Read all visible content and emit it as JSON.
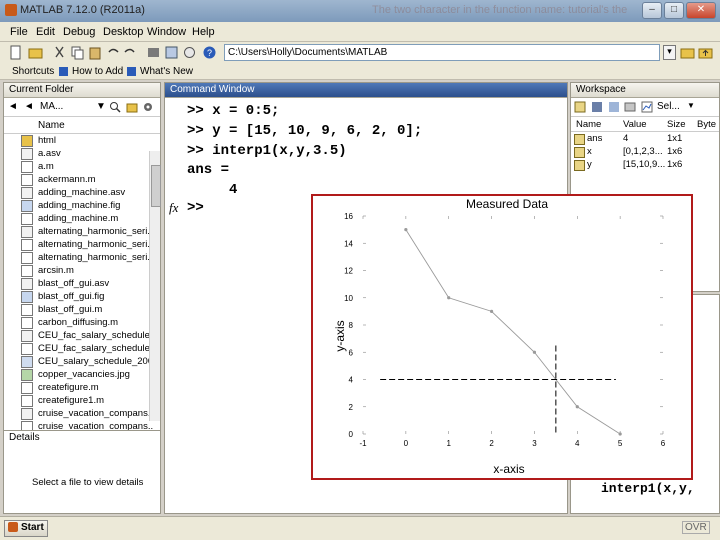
{
  "window": {
    "title": "MATLAB 7.12.0 (R2011a)",
    "background_title": "The two character in the function name: tutorial's the"
  },
  "menu": [
    "File",
    "Edit",
    "Debug",
    "Desktop",
    "Window",
    "Help"
  ],
  "toolbar": {
    "path": "C:\\Users\\Holly\\Documents\\MATLAB"
  },
  "shortcuts": {
    "shortcuts_label": "Shortcuts",
    "how_to_add": "How to Add",
    "whats_new": "What's New"
  },
  "current_folder": {
    "title": "Current Folder",
    "location": "MA...",
    "column_name": "Name",
    "files": [
      {
        "name": "html",
        "icon": "folder-icon"
      },
      {
        "name": "a.asv",
        "icon": "asv-file-icon"
      },
      {
        "name": "a.m",
        "icon": "m-file-icon"
      },
      {
        "name": "ackermann.m",
        "icon": "m-file-icon"
      },
      {
        "name": "adding_machine.asv",
        "icon": "asv-file-icon"
      },
      {
        "name": "adding_machine.fig",
        "icon": "fig-file-icon"
      },
      {
        "name": "adding_machine.m",
        "icon": "m-file-icon"
      },
      {
        "name": "alternating_harmonic_seri...",
        "icon": "asv-file-icon"
      },
      {
        "name": "alternating_harmonic_seri...",
        "icon": "m-file-icon"
      },
      {
        "name": "alternating_harmonic_seri...",
        "icon": "m-file-icon"
      },
      {
        "name": "arcsin.m",
        "icon": "m-file-icon"
      },
      {
        "name": "blast_off_gui.asv",
        "icon": "asv-file-icon"
      },
      {
        "name": "blast_off_gui.fig",
        "icon": "fig-file-icon"
      },
      {
        "name": "blast_off_gui.m",
        "icon": "m-file-icon"
      },
      {
        "name": "carbon_diffusing.m",
        "icon": "m-file-icon"
      },
      {
        "name": "CEU_fac_salary_schedule.a...",
        "icon": "asv-file-icon"
      },
      {
        "name": "CEU_fac_salary_schedule.m",
        "icon": "m-file-icon"
      },
      {
        "name": "CEU_salary_schedule_2008...",
        "icon": "doc-file-icon"
      },
      {
        "name": "copper_vacancies.jpg",
        "icon": "jpg-file-icon"
      },
      {
        "name": "createfigure.m",
        "icon": "m-file-icon"
      },
      {
        "name": "createfigure1.m",
        "icon": "m-file-icon"
      },
      {
        "name": "cruise_vacation_compans...",
        "icon": "asv-file-icon"
      },
      {
        "name": "cruise_vacation_compans...",
        "icon": "m-file-icon"
      }
    ]
  },
  "details": {
    "title": "Details",
    "message": "Select a file to view details"
  },
  "command_window": {
    "title": "Command Window",
    "lines": [
      ">> x = 0:5;",
      ">> y = [15, 10, 9, 6, 2, 0];",
      ">> interp1(x,y,3.5)",
      "ans =",
      "     4",
      ">>"
    ],
    "fx_symbol": "fx"
  },
  "workspace": {
    "title": "Workspace",
    "select_label": "Sel...",
    "columns": [
      "Name",
      "Value",
      "Size",
      "Byte"
    ],
    "vars": [
      {
        "name": "ans",
        "value": "4",
        "size": "1x1"
      },
      {
        "name": "x",
        "value": "[0,1,2,3...",
        "size": "1x6"
      },
      {
        "name": "y",
        "value": "[15,10,9...",
        "size": "1x6"
      }
    ]
  },
  "history": {
    "snippets": [
      ")",
      "u",
      "interp1(x,y,"
    ]
  },
  "status": {
    "start_label": "Start",
    "ovr": "OVR"
  },
  "figure": {
    "chart_data": {
      "type": "line",
      "title": "Measured Data",
      "xlabel": "x-axis",
      "ylabel": "y-axis",
      "x": [
        0,
        1,
        2,
        3,
        4,
        5
      ],
      "y": [
        15,
        10,
        9,
        6,
        2,
        0
      ],
      "xlim": [
        -1,
        6
      ],
      "ylim": [
        0,
        16
      ],
      "xticks": [
        -1,
        0,
        1,
        2,
        3,
        4,
        5,
        6
      ],
      "yticks": [
        0,
        2,
        4,
        6,
        8,
        10,
        12,
        14,
        16
      ],
      "crosshair": {
        "x": 3.5,
        "y": 4
      },
      "line_color": "#9a9a9a",
      "crosshair_color": "#000000"
    }
  }
}
